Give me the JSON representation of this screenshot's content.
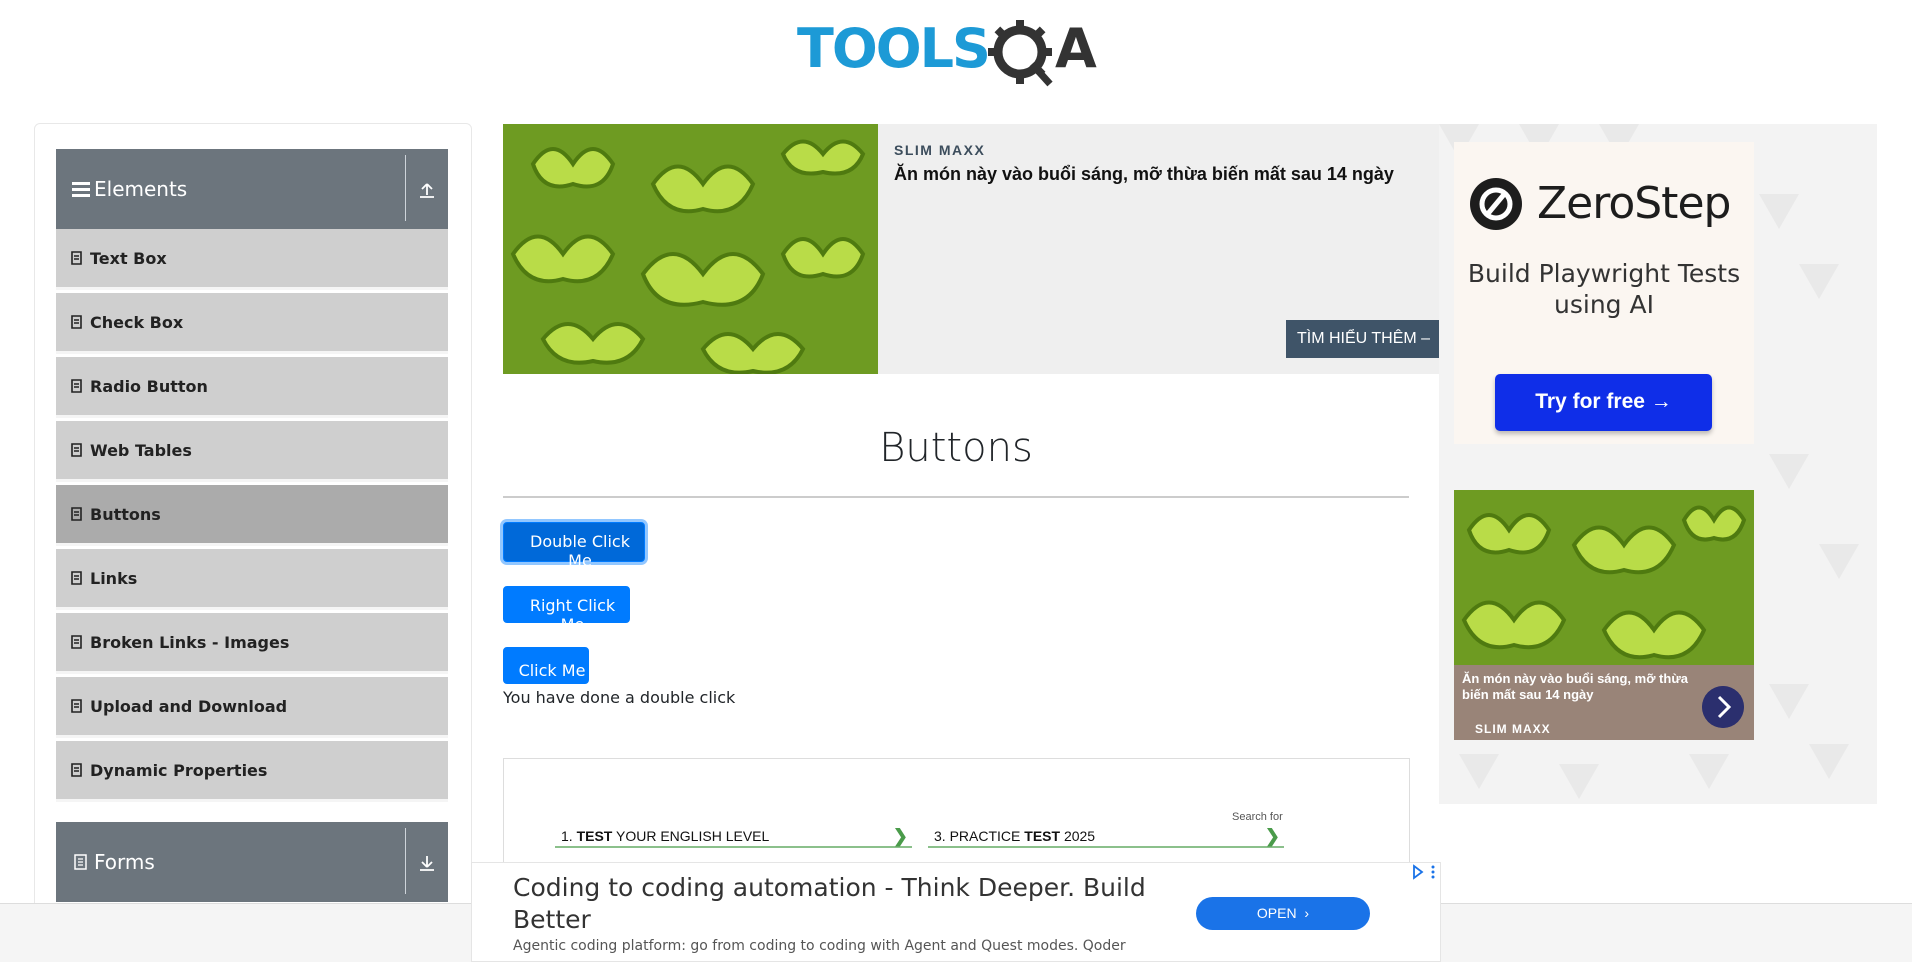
{
  "header": {
    "logo_text": "TOOLSQA"
  },
  "sidebar": {
    "groups": [
      {
        "label": "Elements",
        "icon": "hamburger-icon",
        "toggle": "collapse-up-icon"
      },
      {
        "label": "Forms",
        "icon": "document-icon",
        "toggle": "expand-down-icon"
      }
    ],
    "items": [
      {
        "label": "Text Box"
      },
      {
        "label": "Check Box"
      },
      {
        "label": "Radio Button"
      },
      {
        "label": "Web Tables"
      },
      {
        "label": "Buttons",
        "active": true
      },
      {
        "label": "Links"
      },
      {
        "label": "Broken Links - Images"
      },
      {
        "label": "Upload and Download"
      },
      {
        "label": "Dynamic Properties"
      }
    ]
  },
  "top_ad": {
    "brand": "SLIM MAXX",
    "headline": "Ăn món này vào buổi sáng, mỡ thừa biến mất sau 14 ngày",
    "cta": "TÌM HIỂU THÊM –"
  },
  "right_ad": {
    "brand_name": "ZeroStep",
    "tagline": "Build Playwright Tests using AI",
    "button": "Try for free →",
    "small_ad_text": "Ăn món này vào buổi sáng, mỡ thừa biến mất sau 14 ngày",
    "small_ad_brand": "SLIM MAXX"
  },
  "main": {
    "title": "Buttons",
    "double_click_label": "Double Click Me",
    "right_click_label": "Right Click Me",
    "click_label": "Click Me",
    "message": "You have done a double click"
  },
  "embed_ad": {
    "search_label": "Search for",
    "link1_num": "1.",
    "link1_bold": "TEST",
    "link1_text": "YOUR ENGLISH LEVEL",
    "link2_num": "3.",
    "link2_pre": "PRACTICE",
    "link2_bold": "TEST",
    "link2_text": "2025"
  },
  "bottom_ad": {
    "title": "Coding to coding automation - Think Deeper. Build Better",
    "description": "Agentic coding platform: go from coding to coding with Agent and Quest modes. Qoder",
    "button": "OPEN"
  },
  "colors": {
    "primary": "#007bff",
    "sidebar_header": "#6c757d",
    "menu_item": "#cfcfcf",
    "menu_item_active": "#ababab"
  }
}
